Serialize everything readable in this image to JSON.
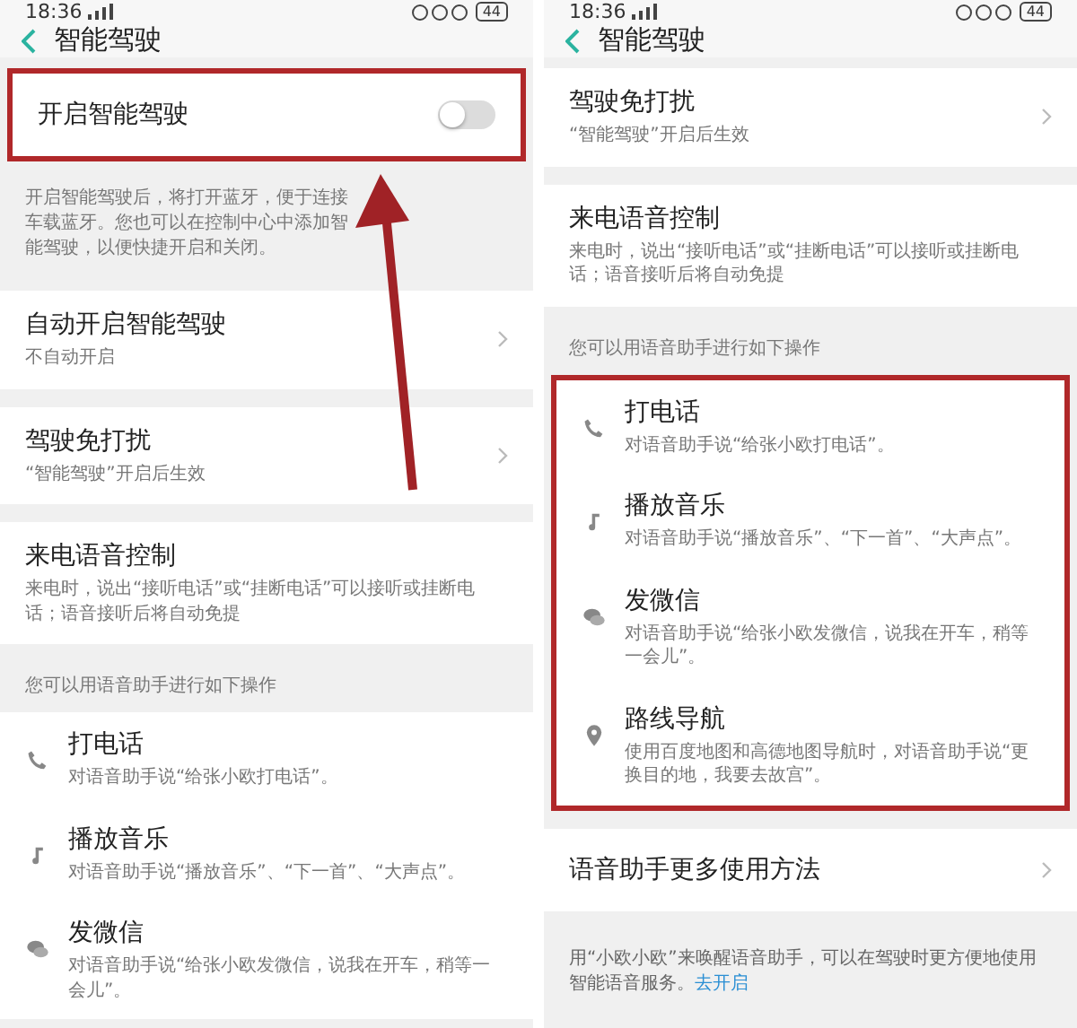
{
  "panels": [
    {
      "status_bar": {
        "time": "18:36",
        "battery": "44"
      },
      "header": {
        "title": "智能驾驶"
      },
      "arrow": true,
      "blocks": [
        {
          "kind": "card",
          "highlighted": true,
          "rows": [
            {
              "kind": "toggle",
              "label": "开启智能驾驶",
              "on": false
            }
          ]
        },
        {
          "kind": "caption",
          "text": "开启智能驾驶后，将打开蓝牙，便于连接车载蓝牙。您也可以在控制中心中添加智能驾驶，以便快捷开启和关闭。"
        },
        {
          "kind": "card",
          "highlighted": false,
          "rows": [
            {
              "kind": "nav",
              "label": "自动开启智能驾驶",
              "subtitle": "不自动开启"
            }
          ]
        },
        {
          "kind": "card",
          "highlighted": false,
          "rows": [
            {
              "kind": "nav",
              "label": "驾驶免打扰",
              "subtitle": "“智能驾驶”开启后生效"
            }
          ]
        },
        {
          "kind": "card",
          "highlighted": false,
          "rows": [
            {
              "kind": "info",
              "label": "来电语音控制",
              "subtitle": "来电时，说出“接听电话”或“挂断电话”可以接听或挂断电话；语音接听后将自动免提"
            }
          ]
        },
        {
          "kind": "section",
          "text": "您可以用语音助手进行如下操作"
        },
        {
          "kind": "card",
          "highlighted": false,
          "rows": [
            {
              "kind": "action",
              "label": "打电话",
              "subtitle": "对语音助手说“给张小欧打电话”。"
            },
            {
              "kind": "action",
              "label": "播放音乐",
              "subtitle": "对语音助手说“播放音乐”、“下一首”、“大声点”。"
            },
            {
              "kind": "action",
              "label": "发微信",
              "subtitle": "对语音助手说“给张小欧发微信，说我在开车，稍等一会儿”。"
            }
          ]
        }
      ]
    },
    {
      "status_bar": {
        "time": "18:36",
        "battery": "44"
      },
      "header": {
        "title": "智能驾驶"
      },
      "blocks": [
        {
          "kind": "card",
          "highlighted": false,
          "rows": [
            {
              "kind": "nav",
              "label": "驾驶免打扰",
              "subtitle": "“智能驾驶”开启后生效"
            }
          ]
        },
        {
          "kind": "card",
          "highlighted": false,
          "rows": [
            {
              "kind": "info",
              "label": "来电语音控制",
              "subtitle": "来电时，说出“接听电话”或“挂断电话”可以接听或挂断电话；语音接听后将自动免提"
            }
          ]
        },
        {
          "kind": "section",
          "text": "您可以用语音助手进行如下操作"
        },
        {
          "kind": "card",
          "highlighted": true,
          "rows": [
            {
              "kind": "action",
              "label": "打电话",
              "subtitle": "对语音助手说“给张小欧打电话”。"
            },
            {
              "kind": "action",
              "label": "播放音乐",
              "subtitle": "对语音助手说“播放音乐”、“下一首”、“大声点”。"
            },
            {
              "kind": "action",
              "label": "发微信",
              "subtitle": "对语音助手说“给张小欧发微信，说我在开车，稍等一会儿”。"
            },
            {
              "kind": "action",
              "label": "路线导航",
              "subtitle": "使用百度地图和高德地图导航时，对语音助手说“更换目的地，我要去故宫”。"
            }
          ]
        },
        {
          "kind": "card",
          "highlighted": false,
          "rows": [
            {
              "kind": "nav",
              "label": "语音助手更多使用方法"
            }
          ]
        },
        {
          "kind": "note",
          "text": "用“小欧小欧”来唤醒语音助手，可以在驾驶时更方便地使用智能语音服务。",
          "link": "去开启"
        }
      ]
    }
  ]
}
